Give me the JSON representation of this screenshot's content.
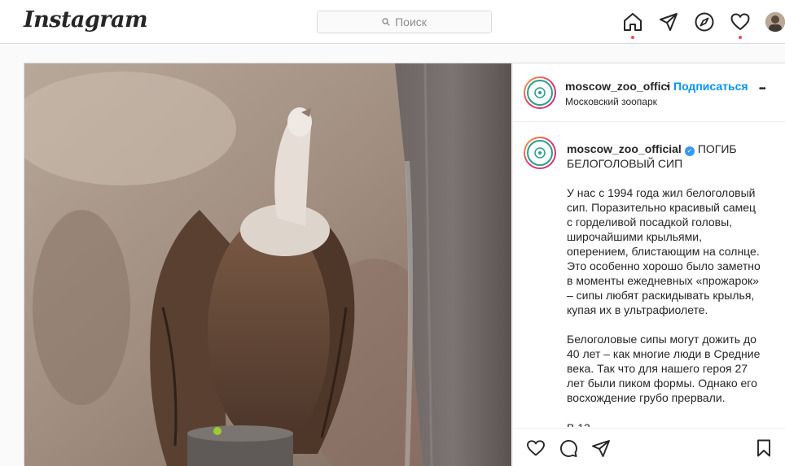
{
  "header": {
    "logo": "Instagram",
    "search_placeholder": "Поиск"
  },
  "icons": {
    "home": "home-icon",
    "direct": "paper-plane-icon",
    "explore": "compass-icon",
    "activity": "heart-icon",
    "profile": "avatar"
  },
  "colors": {
    "accent": "#0095f6",
    "notification": "#ed4956",
    "border": "#dbdbdb"
  },
  "post": {
    "username": "moscow_zoo_offici",
    "dot": "•",
    "follow_label": "Подписаться",
    "location": "Московский зоопарк",
    "more": "•••",
    "caption_username": "moscow_zoo_official",
    "caption_title": "ПОГИБ БЕЛОГОЛОВЫЙ СИП",
    "paragraph1": "У нас с 1994 года жил белоголовый сип. Поразительно красивый самец с горделивой посадкой головы, широчайшими крыльями, оперением, блистающим на солнце. Это особенно хорошо было заметно в моменты ежедневных «прожарок» – сипы любят раскидывать крылья, купая их в ультрафиолете.",
    "paragraph2": "Белоголовые сипы могут дожить до 40 лет – как многие люди в Средние века. Так что для нашего героя 27 лет были пиком формы. Однако его восхождение грубо прервали.",
    "paragraph3_partial": "В       13"
  }
}
